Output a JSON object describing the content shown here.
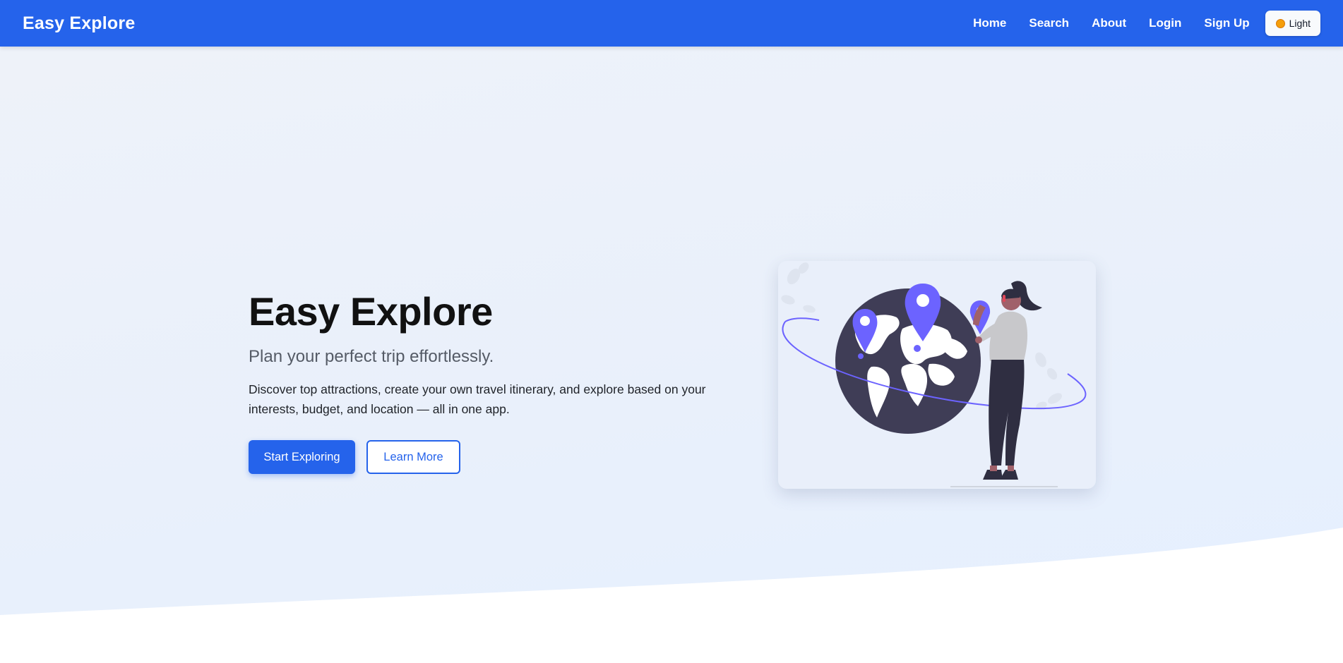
{
  "nav": {
    "brand": "Easy Explore",
    "links": [
      "Home",
      "Search",
      "About",
      "Login",
      "Sign Up"
    ],
    "theme_toggle": {
      "label": "Light",
      "icon": "sun-icon"
    }
  },
  "hero": {
    "title": "Easy Explore",
    "subtitle": "Plan your perfect trip effortlessly.",
    "description": "Discover top attractions, create your own travel itinerary, and explore based on your interests, budget, and location — all in one app.",
    "primary_button": "Start Exploring",
    "secondary_button": "Learn More",
    "illustration": "globe-traveler-illustration"
  },
  "colors": {
    "accent": "#2563eb",
    "pin": "#6c63ff",
    "globe": "#3f3d56"
  }
}
